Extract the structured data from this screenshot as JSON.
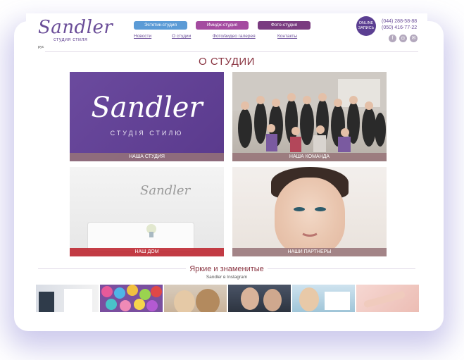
{
  "brand": {
    "logo_text": "Sandler",
    "logo_subtitle": "студия стиля"
  },
  "header": {
    "studios": [
      "Эстетик-студия",
      "Имидж-студия",
      "Фото-студия"
    ],
    "nav": [
      "Новости",
      "О студии",
      "Фото/видео галерея",
      "Контакты"
    ],
    "online_label": "ONLINE ЗАПИСЬ",
    "phones": [
      "(044) 288-58-88",
      "(050) 416-77-22"
    ],
    "social_icons": [
      "facebook-icon",
      "instagram-icon",
      "vk-icon"
    ],
    "language": "рус"
  },
  "main": {
    "title": "О СТУДИИ",
    "tiles": [
      {
        "caption": "НАША СТУДИЯ",
        "logo_text": "Sandler",
        "logo_subtitle": "СТУДІЯ СТИЛЮ"
      },
      {
        "caption": "НАША КОМАНДА"
      },
      {
        "caption": "НАШ ДОМ",
        "logo_text": "Sandler"
      },
      {
        "caption": "НАШИ ПАРТНЕРЫ"
      }
    ]
  },
  "instagram": {
    "title": "Яркие и знаменитые",
    "subtitle": "Sandler в Instagram",
    "photo_count_visible": 6
  },
  "colors": {
    "accent_purple": "#6a4d98",
    "title_red": "#8a3542",
    "pill_blue": "#5b9bd6",
    "pill_magenta": "#a44ba0",
    "pill_purple": "#7a3c80"
  }
}
